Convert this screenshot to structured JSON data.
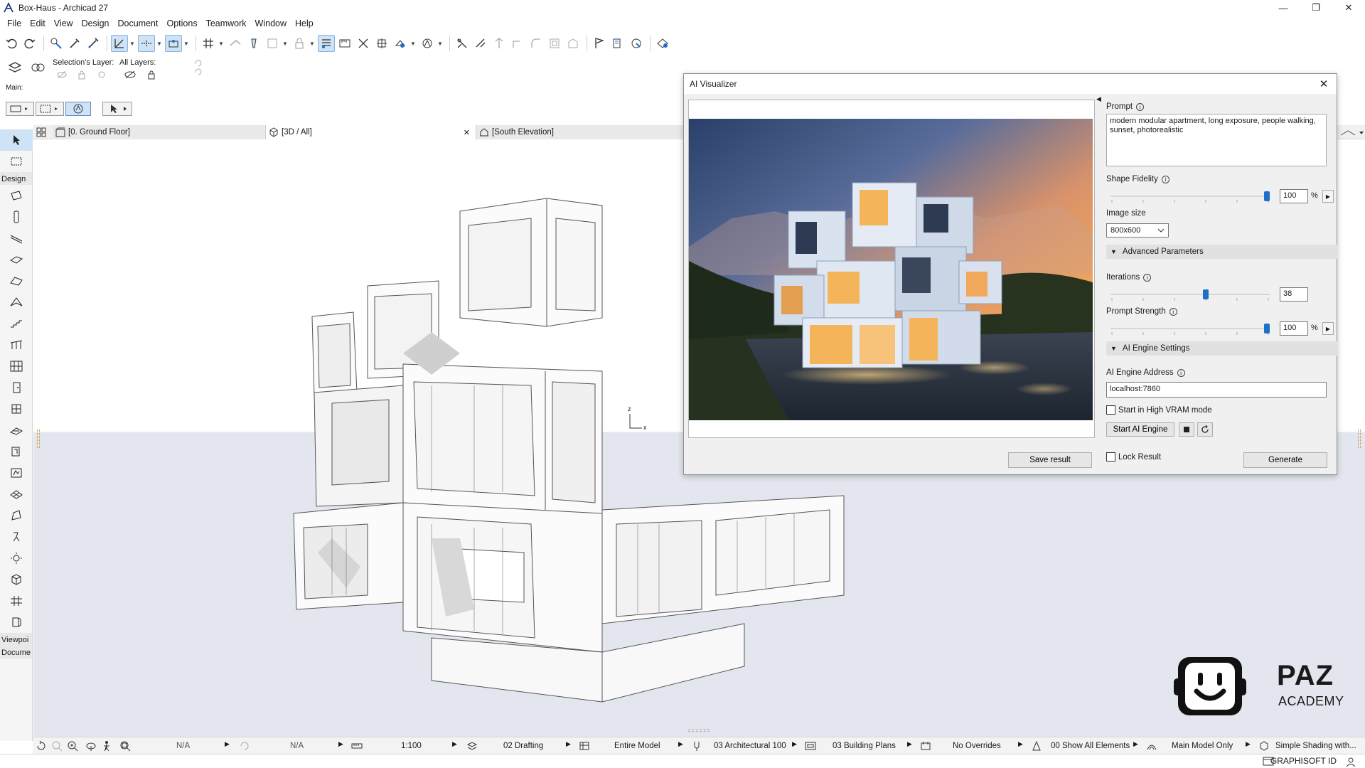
{
  "window": {
    "title": "Box-Haus - Archicad 27",
    "minimize": "—",
    "maximize": "❐",
    "close": "✕"
  },
  "menu": [
    "File",
    "Edit",
    "View",
    "Design",
    "Document",
    "Options",
    "Teamwork",
    "Window",
    "Help"
  ],
  "toolbar2": {
    "selection_layer": "Selection's Layer:",
    "all_layers": "All Layers:",
    "main": "Main:"
  },
  "toolbox": {
    "section_design": "Design",
    "section_viewpoint": "Viewpoi",
    "section_document": "Docume"
  },
  "tabs": [
    {
      "label": "[0. Ground Floor]"
    },
    {
      "label": "[3D / All]",
      "close": "✕"
    },
    {
      "label": "[South Elevation]"
    }
  ],
  "viewport": {
    "axis_z": "z",
    "axis_x": "x"
  },
  "dialog": {
    "title": "AI Visualizer",
    "close": "✕",
    "save_result": "Save result",
    "prompt_label": "Prompt",
    "prompt_value": "modern modular apartment, long exposure, people walking, sunset, photorealistic",
    "shape_fidelity_label": "Shape Fidelity",
    "shape_fidelity_value": "100",
    "shape_fidelity_fraction": 1.0,
    "percent": "%",
    "image_size_label": "Image size",
    "image_size_value": "800x600",
    "advanced_parameters": "Advanced Parameters",
    "iterations_label": "Iterations",
    "iterations_value": "38",
    "iterations_fraction": 0.6,
    "prompt_strength_label": "Prompt Strength",
    "prompt_strength_value": "100",
    "prompt_strength_fraction": 1.0,
    "ai_engine_settings": "AI Engine Settings",
    "ai_engine_address_label": "AI Engine Address",
    "ai_engine_address_value": "localhost:7860",
    "high_vram_label": "Start in High VRAM mode",
    "start_engine": "Start AI Engine",
    "lock_result": "Lock Result",
    "generate": "Generate"
  },
  "statusbar": {
    "na1": "N/A",
    "na2": "N/A",
    "scale": "1:100",
    "layer_combo": "02 Drafting",
    "model_view": "Entire Model",
    "pen_set": "03 Architectural 100",
    "mvo": "03 Building Plans",
    "overrides": "No Overrides",
    "renovation": "00 Show All Elements",
    "structure": "Main Model Only",
    "shading": "Simple Shading with..."
  },
  "bottombar": {
    "graphisoft_id": "GRAPHISOFT ID"
  },
  "logo": {
    "line1": "PAZ",
    "line2": "ACADEMY"
  },
  "colors": {
    "accent": "#1e6fc8",
    "selected_bg": "#cfe3f7",
    "viewport_ground": "#e3e6ee"
  }
}
